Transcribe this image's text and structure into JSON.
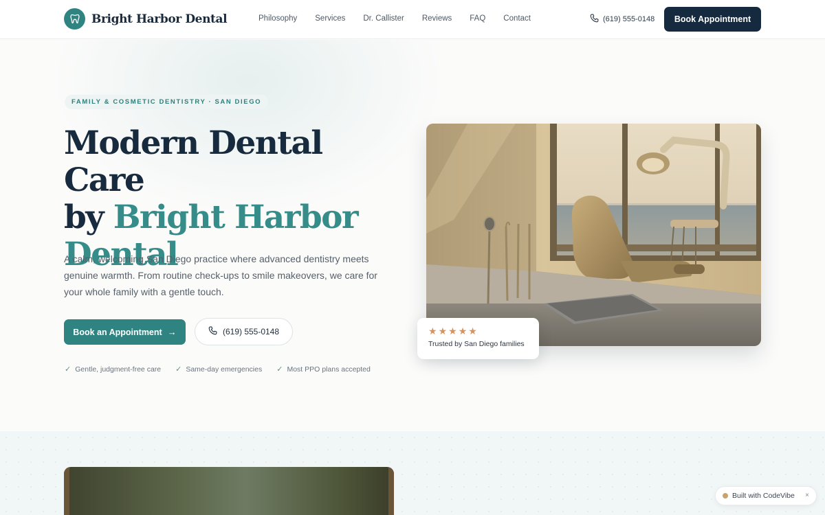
{
  "header": {
    "brand_name": "Bright Harbor Dental",
    "nav": [
      "Philosophy",
      "Services",
      "Dr. Callister",
      "Reviews",
      "FAQ",
      "Contact"
    ],
    "phone": "(619) 555-0148",
    "book_label": "Book Appointment"
  },
  "hero": {
    "eyebrow": "FAMILY & COSMETIC DENTISTRY · SAN DIEGO",
    "headline_line1": "Modern Dental Care",
    "headline_by": "by ",
    "headline_accent1": "Bright Harbor",
    "headline_accent2": "Dental",
    "lede": "A calm, welcoming San Diego practice where advanced dentistry meets genuine warmth. From routine check-ups to smile makeovers, we care for your whole family with a gentle touch.",
    "cta_primary": "Book an Appointment",
    "cta_phone": "(619) 555-0148",
    "checks": [
      "Gentle, judgment-free care",
      "Same-day emergencies",
      "Most PPO plans accepted"
    ],
    "trust": {
      "rating": 5,
      "text": "Trusted by San Diego families"
    }
  },
  "badge": {
    "label": "Built with CodeVibe",
    "close": "×"
  },
  "colors": {
    "navy": "#152a3f",
    "teal": "#2f8482",
    "accent_text": "#358c88",
    "star": "#d8925a"
  },
  "icons": [
    "tooth-icon",
    "phone-icon",
    "arrow-right-icon",
    "check-icon",
    "star-icon",
    "close-icon"
  ]
}
